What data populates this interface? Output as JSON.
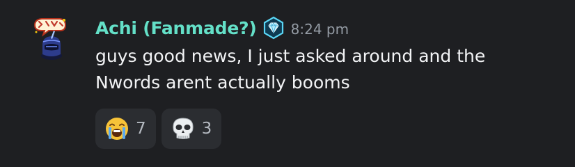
{
  "message": {
    "author": "Achi (Fanmade?)",
    "timestamp": "8:24 pm",
    "lines": [
      "guys good news, I just asked around and the",
      "Nwords arent actually booms"
    ],
    "name_color": "#64e0c8",
    "badge_icon": "diamond-badge-icon",
    "avatar_icon": "avatar-image"
  },
  "reactions": [
    {
      "icon": "loudly-crying-face-emoji",
      "count": "7"
    },
    {
      "icon": "skull-emoji",
      "count": "3"
    }
  ]
}
